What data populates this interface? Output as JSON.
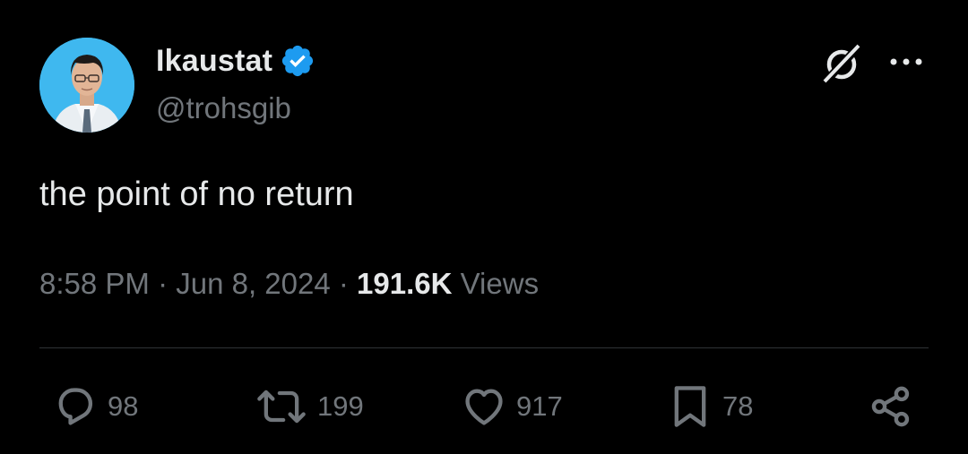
{
  "author": {
    "display_name": "Ikaustat",
    "handle": "@trohsgib",
    "verified": true
  },
  "tweet": {
    "text": "the point of no return"
  },
  "meta": {
    "time": "8:58 PM",
    "sep1": " · ",
    "date": "Jun 8, 2024",
    "sep2": " · ",
    "views_count": "191.6K",
    "views_label": " Views"
  },
  "actions": {
    "replies": "98",
    "reposts": "199",
    "likes": "917",
    "bookmarks": "78"
  },
  "icons": {
    "verified": "verified-badge-icon",
    "grok": "grok-icon",
    "more": "more-dots-icon",
    "reply": "reply-icon",
    "repost": "repost-icon",
    "like": "heart-icon",
    "bookmark": "bookmark-icon",
    "share": "share-icon"
  },
  "colors": {
    "background": "#000000",
    "primary_text": "#e7e9ea",
    "secondary_text": "#71767b",
    "verified_blue": "#1d9bf0",
    "divider": "#2f3336"
  }
}
